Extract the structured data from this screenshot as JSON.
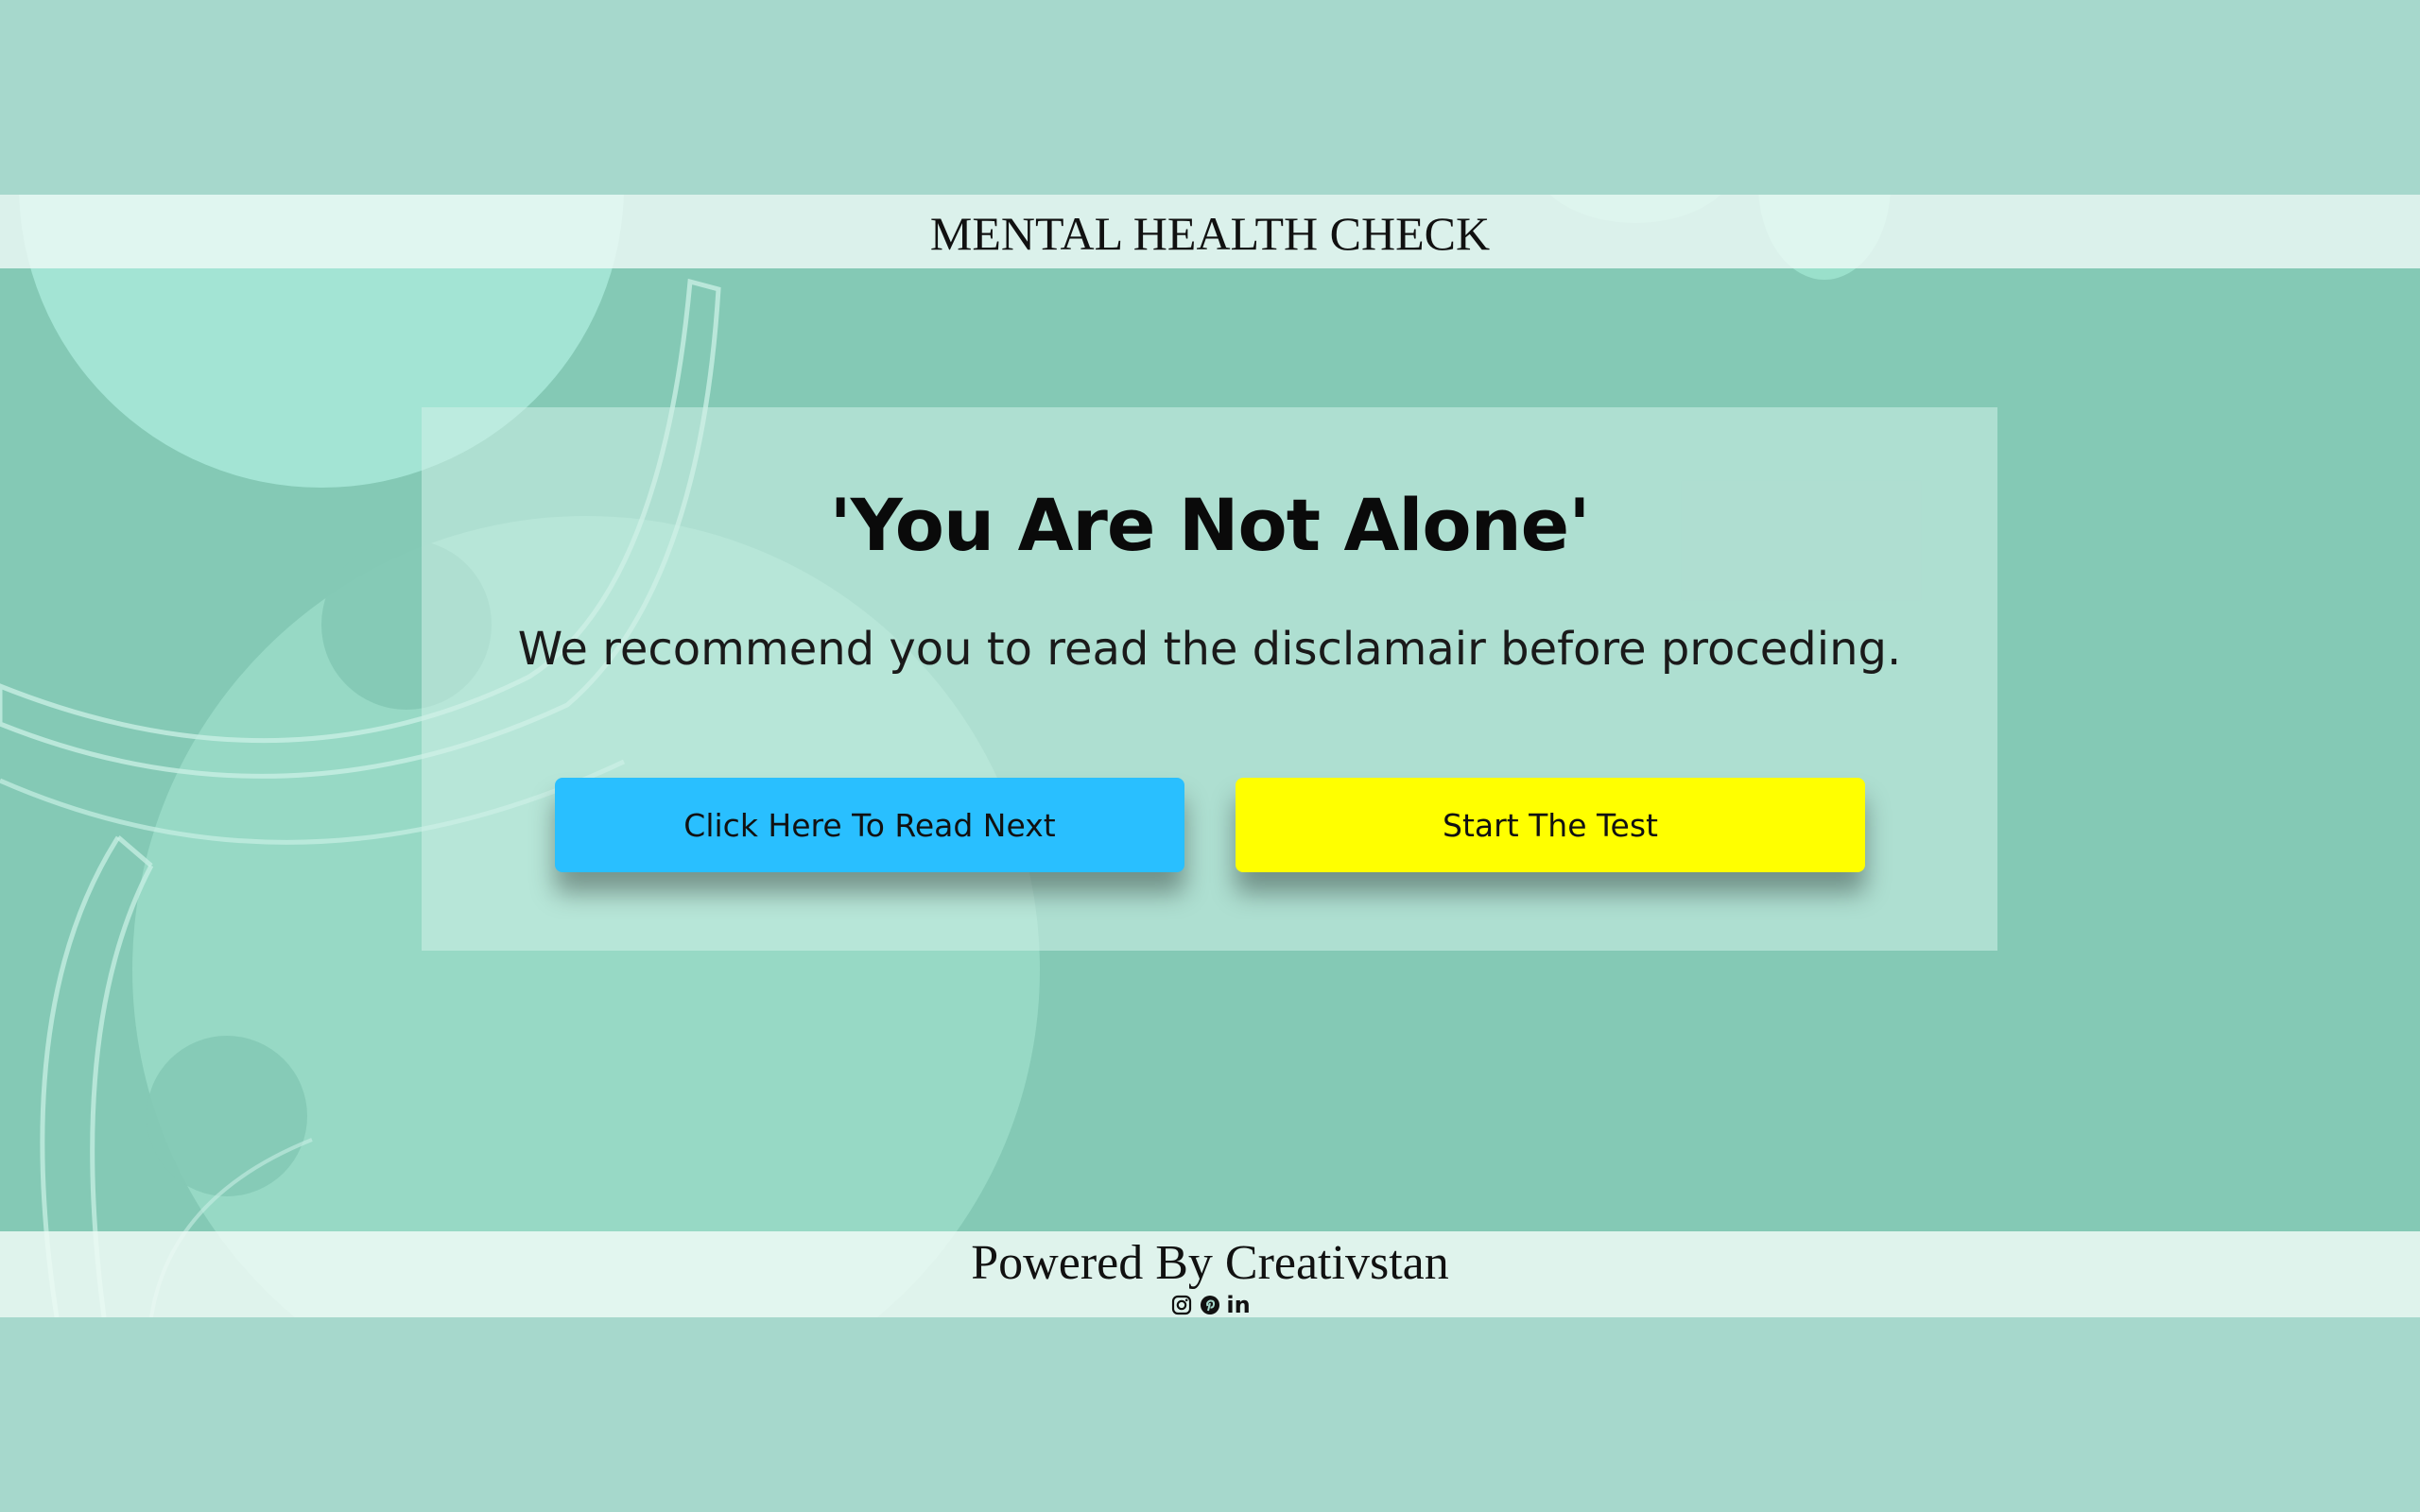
{
  "header": {
    "title": "MENTAL HEALTH CHECK"
  },
  "card": {
    "heading": "'You Are Not Alone'",
    "text": "We recommend you to read the disclamair before proceding.",
    "read_button_label": "Click Here To Read Next",
    "test_button_label": "Start The Test"
  },
  "footer": {
    "text": "Powered By Creativstan",
    "social": {
      "instagram_icon": "instagram-icon",
      "pinterest_icon": "pinterest-icon",
      "linkedin_icon": "linkedin-icon",
      "linkedin_label": "in"
    }
  },
  "colors": {
    "page_background": "#a6d8cc",
    "hero_background": "#84c9b5",
    "read_button": "#29bfff",
    "test_button": "#ffff00"
  }
}
